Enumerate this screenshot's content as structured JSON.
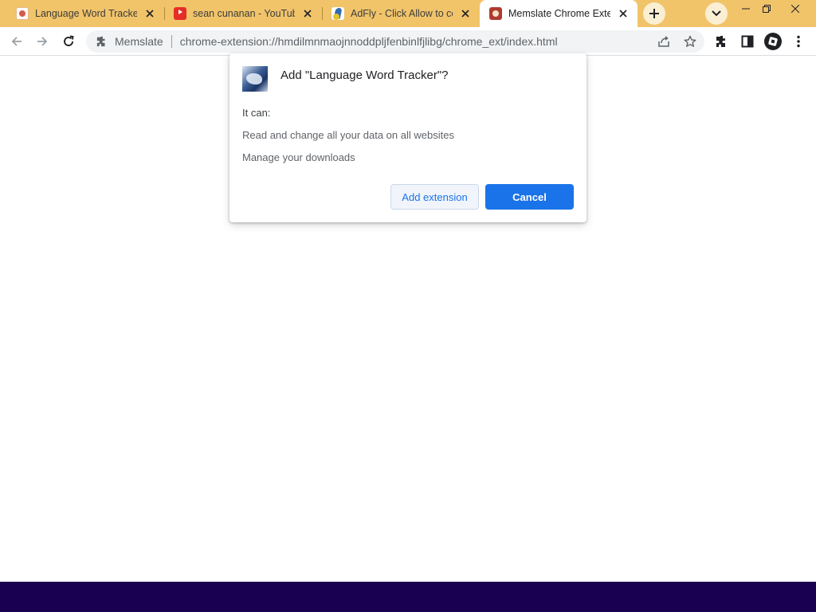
{
  "tabs": [
    {
      "title": "Language Word Tracker - ",
      "favicon": "language-word-tracker-favicon",
      "active": false
    },
    {
      "title": "sean cunanan - YouTube",
      "favicon": "youtube-favicon",
      "active": false
    },
    {
      "title": "AdFly - Click Allow to co",
      "favicon": "adfly-favicon",
      "active": false
    },
    {
      "title": "Memslate Chrome Exten",
      "favicon": "memslate-favicon",
      "active": true
    }
  ],
  "toolbar": {
    "site_name": "Memslate",
    "url": "chrome-extension://hmdilmnmaojnnoddpljfenbinlfjlibg/chrome_ext/index.html"
  },
  "dialog": {
    "title": "Add \"Language Word Tracker\"?",
    "intro": "It can:",
    "permissions": [
      "Read and change all your data on all websites",
      "Manage your downloads"
    ],
    "add_label": "Add extension",
    "cancel_label": "Cancel"
  },
  "colors": {
    "tabstrip": "#f1c46a",
    "accent_blue": "#1a73e8",
    "taskbar": "#1a0050"
  }
}
